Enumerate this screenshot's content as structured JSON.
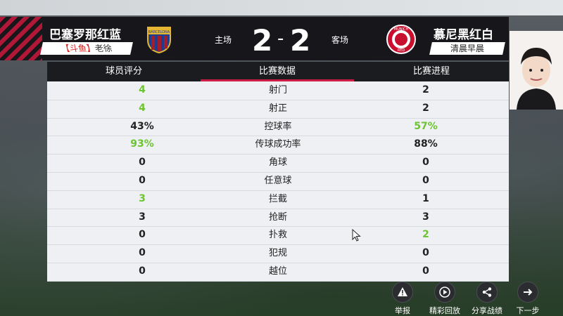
{
  "header": {
    "home": {
      "name": "巴塞罗那红蓝",
      "tag_prefix": "【斗鱼】",
      "tag_name": "老徐",
      "side": "主场",
      "score": "2",
      "crest_text": "BARCELONA"
    },
    "away": {
      "name": "慕尼黑红白",
      "tag": "清晨早晨",
      "side": "客场",
      "score": "2",
      "crest_text_top": "MUNICH",
      "crest_text_bottom": "RED"
    },
    "score_separator": "-"
  },
  "tabs": [
    {
      "label": "球员评分",
      "active": false
    },
    {
      "label": "比赛数据",
      "active": true
    },
    {
      "label": "比赛进程",
      "active": false
    }
  ],
  "stats": [
    {
      "label": "射门",
      "home": "4",
      "away": "2",
      "highlight": "home"
    },
    {
      "label": "射正",
      "home": "4",
      "away": "2",
      "highlight": "home"
    },
    {
      "label": "控球率",
      "home": "43%",
      "away": "57%",
      "highlight": "away"
    },
    {
      "label": "传球成功率",
      "home": "93%",
      "away": "88%",
      "highlight": "home"
    },
    {
      "label": "角球",
      "home": "0",
      "away": "0",
      "highlight": "none"
    },
    {
      "label": "任意球",
      "home": "0",
      "away": "0",
      "highlight": "none"
    },
    {
      "label": "拦截",
      "home": "3",
      "away": "1",
      "highlight": "home"
    },
    {
      "label": "抢断",
      "home": "3",
      "away": "3",
      "highlight": "none"
    },
    {
      "label": "扑救",
      "home": "0",
      "away": "2",
      "highlight": "away"
    },
    {
      "label": "犯规",
      "home": "0",
      "away": "0",
      "highlight": "none"
    },
    {
      "label": "越位",
      "home": "0",
      "away": "0",
      "highlight": "none"
    }
  ],
  "footer": {
    "report": {
      "label": "举报",
      "icon": "warning-icon"
    },
    "replay": {
      "label": "精彩回放",
      "icon": "play-icon"
    },
    "share": {
      "label": "分享战绩",
      "icon": "share-icon"
    },
    "next": {
      "label": "下一步",
      "icon": "arrow-right-icon"
    }
  },
  "colors": {
    "accent": "#cf1c44",
    "highlight_green": "#6cc431",
    "header_bg": "#17171b"
  }
}
